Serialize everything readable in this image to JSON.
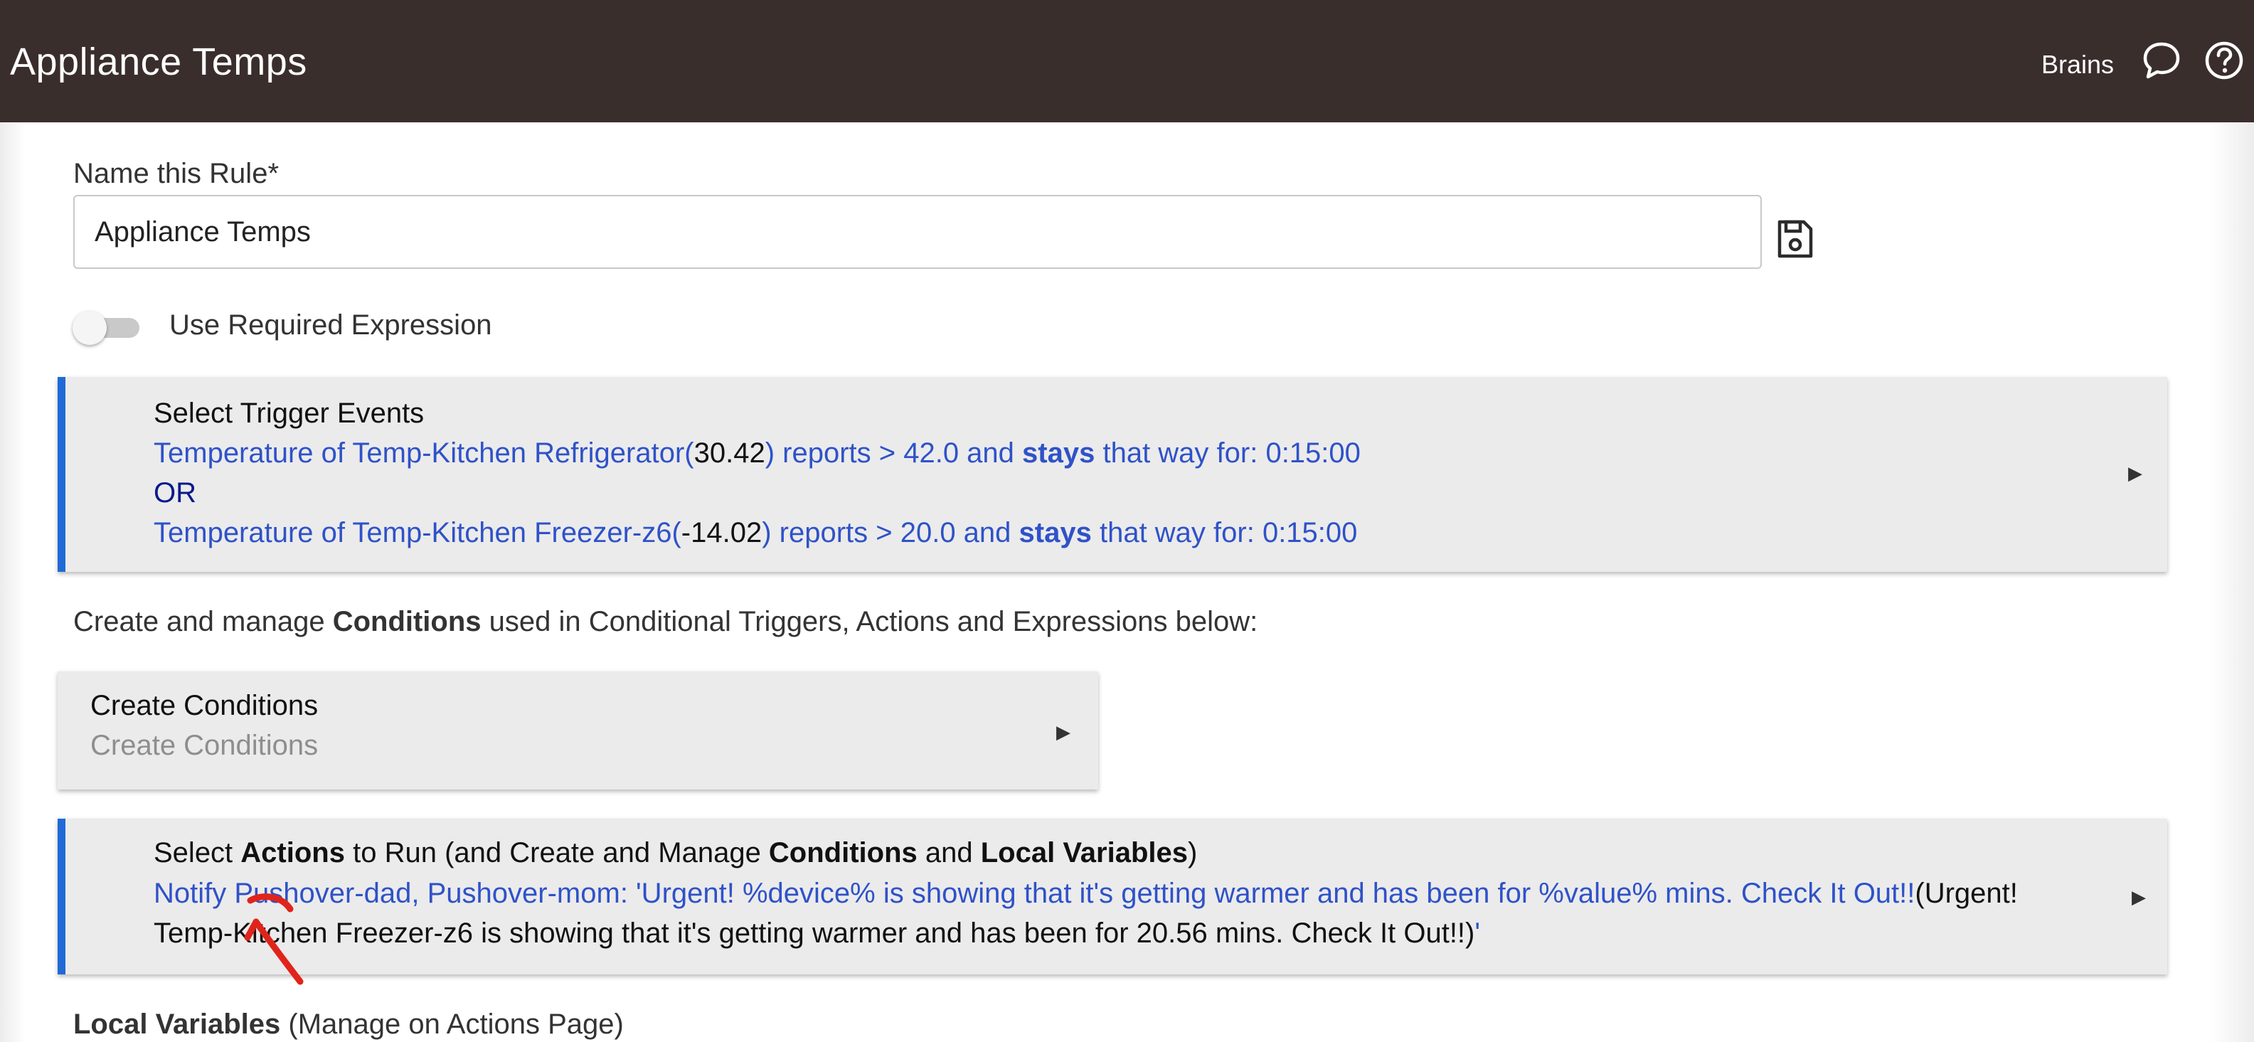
{
  "header": {
    "title": "Appliance Temps",
    "user_label": "Brains",
    "chat_icon": "chat-bubble-icon",
    "help_icon": "help-circle-icon"
  },
  "rule_name": {
    "label": "Name this Rule*",
    "value": "Appliance Temps",
    "save_icon": "floppy-disk-icon"
  },
  "required_expression": {
    "label": "Use Required Expression",
    "enabled": false
  },
  "triggers": {
    "heading": "Select Trigger Events",
    "trigger1": {
      "prefix": "Temperature of Temp-Kitchen Refrigerator(",
      "current": "30.42",
      "mid": ") reports > 42.0 and ",
      "stays": "stays",
      "suffix": " that way for: 0:15:00"
    },
    "or_label": "OR",
    "trigger2": {
      "prefix": "Temperature of Temp-Kitchen Freezer-z6(",
      "current": "-14.02",
      "mid": ") reports > 20.0 and ",
      "stays": "stays",
      "suffix": " that way for: 0:15:00"
    }
  },
  "conditions_intro": {
    "before": "Create and manage ",
    "bold": "Conditions",
    "after": " used in Conditional Triggers, Actions and Expressions below:"
  },
  "create_conditions": {
    "title": "Create Conditions",
    "subtitle": "Create Conditions"
  },
  "actions": {
    "heading_1": "Select ",
    "heading_actions": "Actions",
    "heading_2": " to Run (and Create and Manage ",
    "heading_conditions": "Conditions",
    "heading_3": " and ",
    "heading_locals": "Local Variables",
    "heading_4": ")",
    "notify_text": "Notify Pushover-dad, Pushover-mom: 'Urgent! %device%  is showing that it's getting warmer and has been for  %value% mins.   Check It Out!!",
    "resolved_part1": "(Urgent!",
    "resolved_part2": "Temp-Kitchen Freezer-z6  is showing that it's getting warmer and has been for  20.56 mins.   Check It Out!!)",
    "closing_quote": "'"
  },
  "local_variables": {
    "bold": "Local Variables",
    "rest": " (Manage on Actions Page)"
  },
  "colors": {
    "header_bg": "#3a2e2c",
    "accent_bar": "#1f6ad6",
    "link_blue": "#2f52c8",
    "panel_bg": "#ebebeb"
  }
}
